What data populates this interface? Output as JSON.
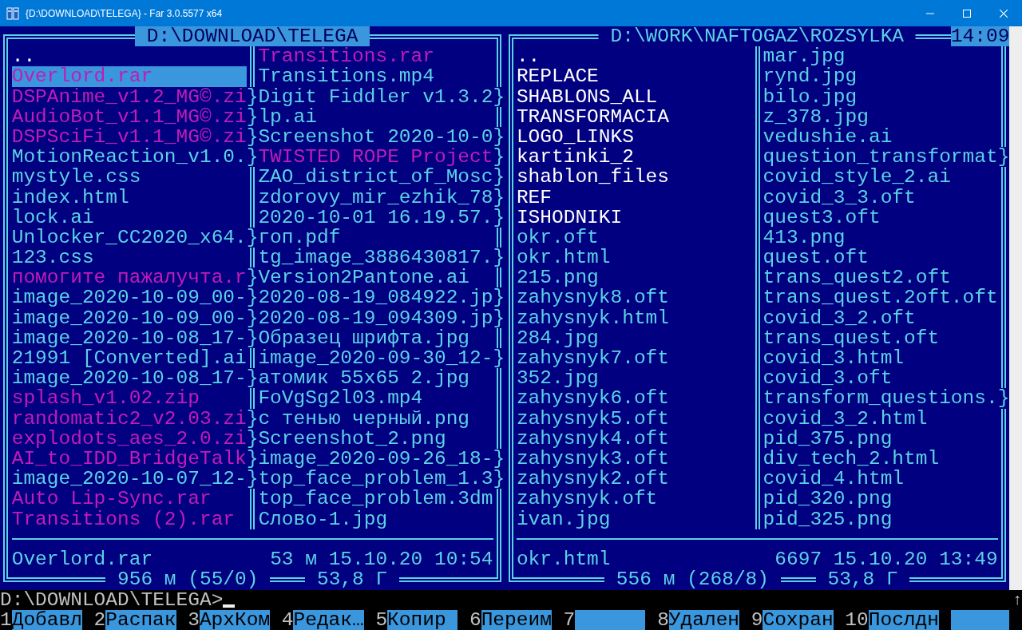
{
  "window": {
    "title": "{D:\\DOWNLOAD\\TELEGA} - Far 3.0.5577 x64"
  },
  "clock": "14:09",
  "panels": [
    {
      "path": "D:\\DOWNLOAD\\TELEGA",
      "active": true,
      "columns": [
        {
          "files": [
            {
              "name": "..",
              "kind": "dir",
              "selected": false
            },
            {
              "name": "Overlord.rar",
              "kind": "archive",
              "selected": true
            },
            {
              "name": "DSPAnime_v1.2_MG©.zi",
              "kind": "archive",
              "selected": false,
              "marker": "}"
            },
            {
              "name": "AudioBot_v1.1_MG©.zi",
              "kind": "archive",
              "selected": false,
              "marker": "}"
            },
            {
              "name": "DSPSciFi_v1.1_MG©.zi",
              "kind": "archive",
              "selected": false,
              "marker": "}"
            },
            {
              "name": "MotionReaction_v1.0.",
              "kind": "file",
              "selected": false,
              "marker": "}"
            },
            {
              "name": "mystyle.css",
              "kind": "file",
              "selected": false
            },
            {
              "name": "index.html",
              "kind": "file",
              "selected": false
            },
            {
              "name": "lock.ai",
              "kind": "file",
              "selected": false
            },
            {
              "name": "Unlocker_CC2020_x64.",
              "kind": "file",
              "selected": false,
              "marker": "}"
            },
            {
              "name": "123.css",
              "kind": "file",
              "selected": false
            },
            {
              "name": "помогите пажалучта.r",
              "kind": "archive",
              "selected": false,
              "marker": "}"
            },
            {
              "name": "image_2020-10-09_00-",
              "kind": "file",
              "selected": false,
              "marker": "}"
            },
            {
              "name": "image_2020-10-09_00-",
              "kind": "file",
              "selected": false,
              "marker": "}"
            },
            {
              "name": "image_2020-10-08_17-",
              "kind": "file",
              "selected": false,
              "marker": "}"
            },
            {
              "name": "21991 [Converted].ai",
              "kind": "file",
              "selected": false
            },
            {
              "name": "image_2020-10-08_17-",
              "kind": "file",
              "selected": false,
              "marker": "}"
            },
            {
              "name": "splash_v1.02.zip",
              "kind": "archive",
              "selected": false
            },
            {
              "name": "randomatic2_v2.03.zi",
              "kind": "archive",
              "selected": false,
              "marker": "}"
            },
            {
              "name": "explodots_aes_2.0.zi",
              "kind": "archive",
              "selected": false,
              "marker": "}"
            },
            {
              "name": "AI_to_IDD_BridgeTalk",
              "kind": "archive",
              "selected": false,
              "marker": "}"
            },
            {
              "name": "image_2020-10-07_12-",
              "kind": "file",
              "selected": false,
              "marker": "}"
            },
            {
              "name": "Auto Lip-Sync.rar",
              "kind": "archive",
              "selected": false
            },
            {
              "name": "Transitions (2).rar",
              "kind": "archive",
              "selected": false
            }
          ]
        },
        {
          "files": [
            {
              "name": "Transitions.rar",
              "kind": "archive",
              "selected": false
            },
            {
              "name": "Transitions.mp4",
              "kind": "file",
              "selected": false
            },
            {
              "name": "Digit Fiddler v1.3.2",
              "kind": "file",
              "selected": false,
              "marker": "}"
            },
            {
              "name": "lp.ai",
              "kind": "file",
              "selected": false
            },
            {
              "name": "Screenshot 2020-10-0",
              "kind": "file",
              "selected": false,
              "marker": "}"
            },
            {
              "name": "TWISTED ROPE Project",
              "kind": "archive",
              "selected": false,
              "marker": "}"
            },
            {
              "name": "ZAO_district_of_Mosc",
              "kind": "file",
              "selected": false,
              "marker": "}"
            },
            {
              "name": "zdorovy_mir_ezhik_78",
              "kind": "file",
              "selected": false,
              "marker": "}"
            },
            {
              "name": "2020-10-01 16.19.57.",
              "kind": "file",
              "selected": false,
              "marker": "}"
            },
            {
              "name": "гоп.pdf",
              "kind": "file",
              "selected": false
            },
            {
              "name": "tg_image_3886430817.",
              "kind": "file",
              "selected": false,
              "marker": "}"
            },
            {
              "name": "Version2Pantone.ai",
              "kind": "file",
              "selected": false
            },
            {
              "name": "2020-08-19_084922.jp",
              "kind": "file",
              "selected": false,
              "marker": "}"
            },
            {
              "name": "2020-08-19_094309.jp",
              "kind": "file",
              "selected": false,
              "marker": "}"
            },
            {
              "name": "Образец шрифта.jpg",
              "kind": "file",
              "selected": false
            },
            {
              "name": "image_2020-09-30_12-",
              "kind": "file",
              "selected": false,
              "marker": "}"
            },
            {
              "name": "атомик 55x65 2.jpg",
              "kind": "file",
              "selected": false
            },
            {
              "name": "FoVgSg2l03.mp4",
              "kind": "file",
              "selected": false
            },
            {
              "name": "с тенью черный.png",
              "kind": "file",
              "selected": false
            },
            {
              "name": "Screenshot_2.png",
              "kind": "file",
              "selected": false
            },
            {
              "name": "image_2020-09-26_18-",
              "kind": "file",
              "selected": false,
              "marker": "}"
            },
            {
              "name": "top_face_problem_1.3",
              "kind": "file",
              "selected": false,
              "marker": "}"
            },
            {
              "name": "top_face_problem.3dm",
              "kind": "file",
              "selected": false
            },
            {
              "name": "Слово-1.jpg",
              "kind": "file",
              "selected": false
            }
          ]
        }
      ],
      "status": {
        "name": "Overlord.rar",
        "info": "53 м 15.10.20 10:54"
      },
      "totals": [
        "956 м (55/0)",
        "53,8 Г"
      ]
    },
    {
      "path": "D:\\WORK\\NAFTOGAZ\\ROZSYLKA",
      "active": false,
      "columns": [
        {
          "files": [
            {
              "name": "..",
              "kind": "dir",
              "selected": false
            },
            {
              "name": "REPLACE",
              "kind": "dir",
              "selected": false
            },
            {
              "name": "SHABLONS_ALL",
              "kind": "dir",
              "selected": false
            },
            {
              "name": "TRANSFORMACIA",
              "kind": "dir",
              "selected": false
            },
            {
              "name": "LOGO_LINKS",
              "kind": "dir",
              "selected": false
            },
            {
              "name": "kartinki_2",
              "kind": "dir",
              "selected": false
            },
            {
              "name": "shablon_files",
              "kind": "dir",
              "selected": false
            },
            {
              "name": "REF",
              "kind": "dir",
              "selected": false
            },
            {
              "name": "ISHODNIKI",
              "kind": "dir",
              "selected": false
            },
            {
              "name": "okr.oft",
              "kind": "file",
              "selected": false
            },
            {
              "name": "okr.html",
              "kind": "file",
              "selected": false
            },
            {
              "name": "215.png",
              "kind": "file",
              "selected": false
            },
            {
              "name": "zahysnyk8.oft",
              "kind": "file",
              "selected": false
            },
            {
              "name": "zahysnyk.html",
              "kind": "file",
              "selected": false
            },
            {
              "name": "284.jpg",
              "kind": "file",
              "selected": false
            },
            {
              "name": "zahysnyk7.oft",
              "kind": "file",
              "selected": false
            },
            {
              "name": "352.jpg",
              "kind": "file",
              "selected": false
            },
            {
              "name": "zahysnyk6.oft",
              "kind": "file",
              "selected": false
            },
            {
              "name": "zahysnyk5.oft",
              "kind": "file",
              "selected": false
            },
            {
              "name": "zahysnyk4.oft",
              "kind": "file",
              "selected": false
            },
            {
              "name": "zahysnyk3.oft",
              "kind": "file",
              "selected": false
            },
            {
              "name": "zahysnyk2.oft",
              "kind": "file",
              "selected": false
            },
            {
              "name": "zahysnyk.oft",
              "kind": "file",
              "selected": false
            },
            {
              "name": "ivan.jpg",
              "kind": "file",
              "selected": false
            }
          ]
        },
        {
          "files": [
            {
              "name": "mar.jpg",
              "kind": "file",
              "selected": false
            },
            {
              "name": "rynd.jpg",
              "kind": "file",
              "selected": false
            },
            {
              "name": "bilo.jpg",
              "kind": "file",
              "selected": false
            },
            {
              "name": "z_378.jpg",
              "kind": "file",
              "selected": false
            },
            {
              "name": "vedushie.ai",
              "kind": "file",
              "selected": false
            },
            {
              "name": "question_transformat",
              "kind": "file",
              "selected": false,
              "marker": "}"
            },
            {
              "name": "covid_style_2.ai",
              "kind": "file",
              "selected": false
            },
            {
              "name": "covid_3_3.oft",
              "kind": "file",
              "selected": false
            },
            {
              "name": "quest3.oft",
              "kind": "file",
              "selected": false
            },
            {
              "name": "413.png",
              "kind": "file",
              "selected": false
            },
            {
              "name": "quest.oft",
              "kind": "file",
              "selected": false
            },
            {
              "name": "trans_quest2.oft",
              "kind": "file",
              "selected": false
            },
            {
              "name": "trans_quest.2oft.oft",
              "kind": "file",
              "selected": false
            },
            {
              "name": "covid_3_2.oft",
              "kind": "file",
              "selected": false
            },
            {
              "name": "trans_quest.oft",
              "kind": "file",
              "selected": false
            },
            {
              "name": "covid_3.html",
              "kind": "file",
              "selected": false
            },
            {
              "name": "covid_3.oft",
              "kind": "file",
              "selected": false
            },
            {
              "name": "transform_questions.",
              "kind": "file",
              "selected": false,
              "marker": "}"
            },
            {
              "name": "covid_3_2.html",
              "kind": "file",
              "selected": false
            },
            {
              "name": "pid_375.png",
              "kind": "file",
              "selected": false
            },
            {
              "name": "div_tech_2.html",
              "kind": "file",
              "selected": false
            },
            {
              "name": "covid_4.html",
              "kind": "file",
              "selected": false
            },
            {
              "name": "pid_320.png",
              "kind": "file",
              "selected": false
            },
            {
              "name": "pid_325.png",
              "kind": "file",
              "selected": false
            }
          ]
        }
      ],
      "status": {
        "name": "okr.html",
        "info": "6697 15.10.20 13:49"
      },
      "totals": [
        "556 м (268/8)",
        "53,8 Г"
      ]
    }
  ],
  "command_line": {
    "prompt": "D:\\DOWNLOAD\\TELEGA>",
    "scroll_arrow": "↑"
  },
  "keybar": [
    {
      "key": "1",
      "label": "Добавл"
    },
    {
      "key": "2",
      "label": "Распак"
    },
    {
      "key": "3",
      "label": "АрхКом"
    },
    {
      "key": "4",
      "label": "Редак…"
    },
    {
      "key": "5",
      "label": "Копир"
    },
    {
      "key": "6",
      "label": "Переим"
    },
    {
      "key": "7"
    },
    {
      "key": "8",
      "label": "Удален"
    },
    {
      "key": "9",
      "label": "Сохран"
    },
    {
      "key": "10",
      "label": "Послдн"
    }
  ]
}
